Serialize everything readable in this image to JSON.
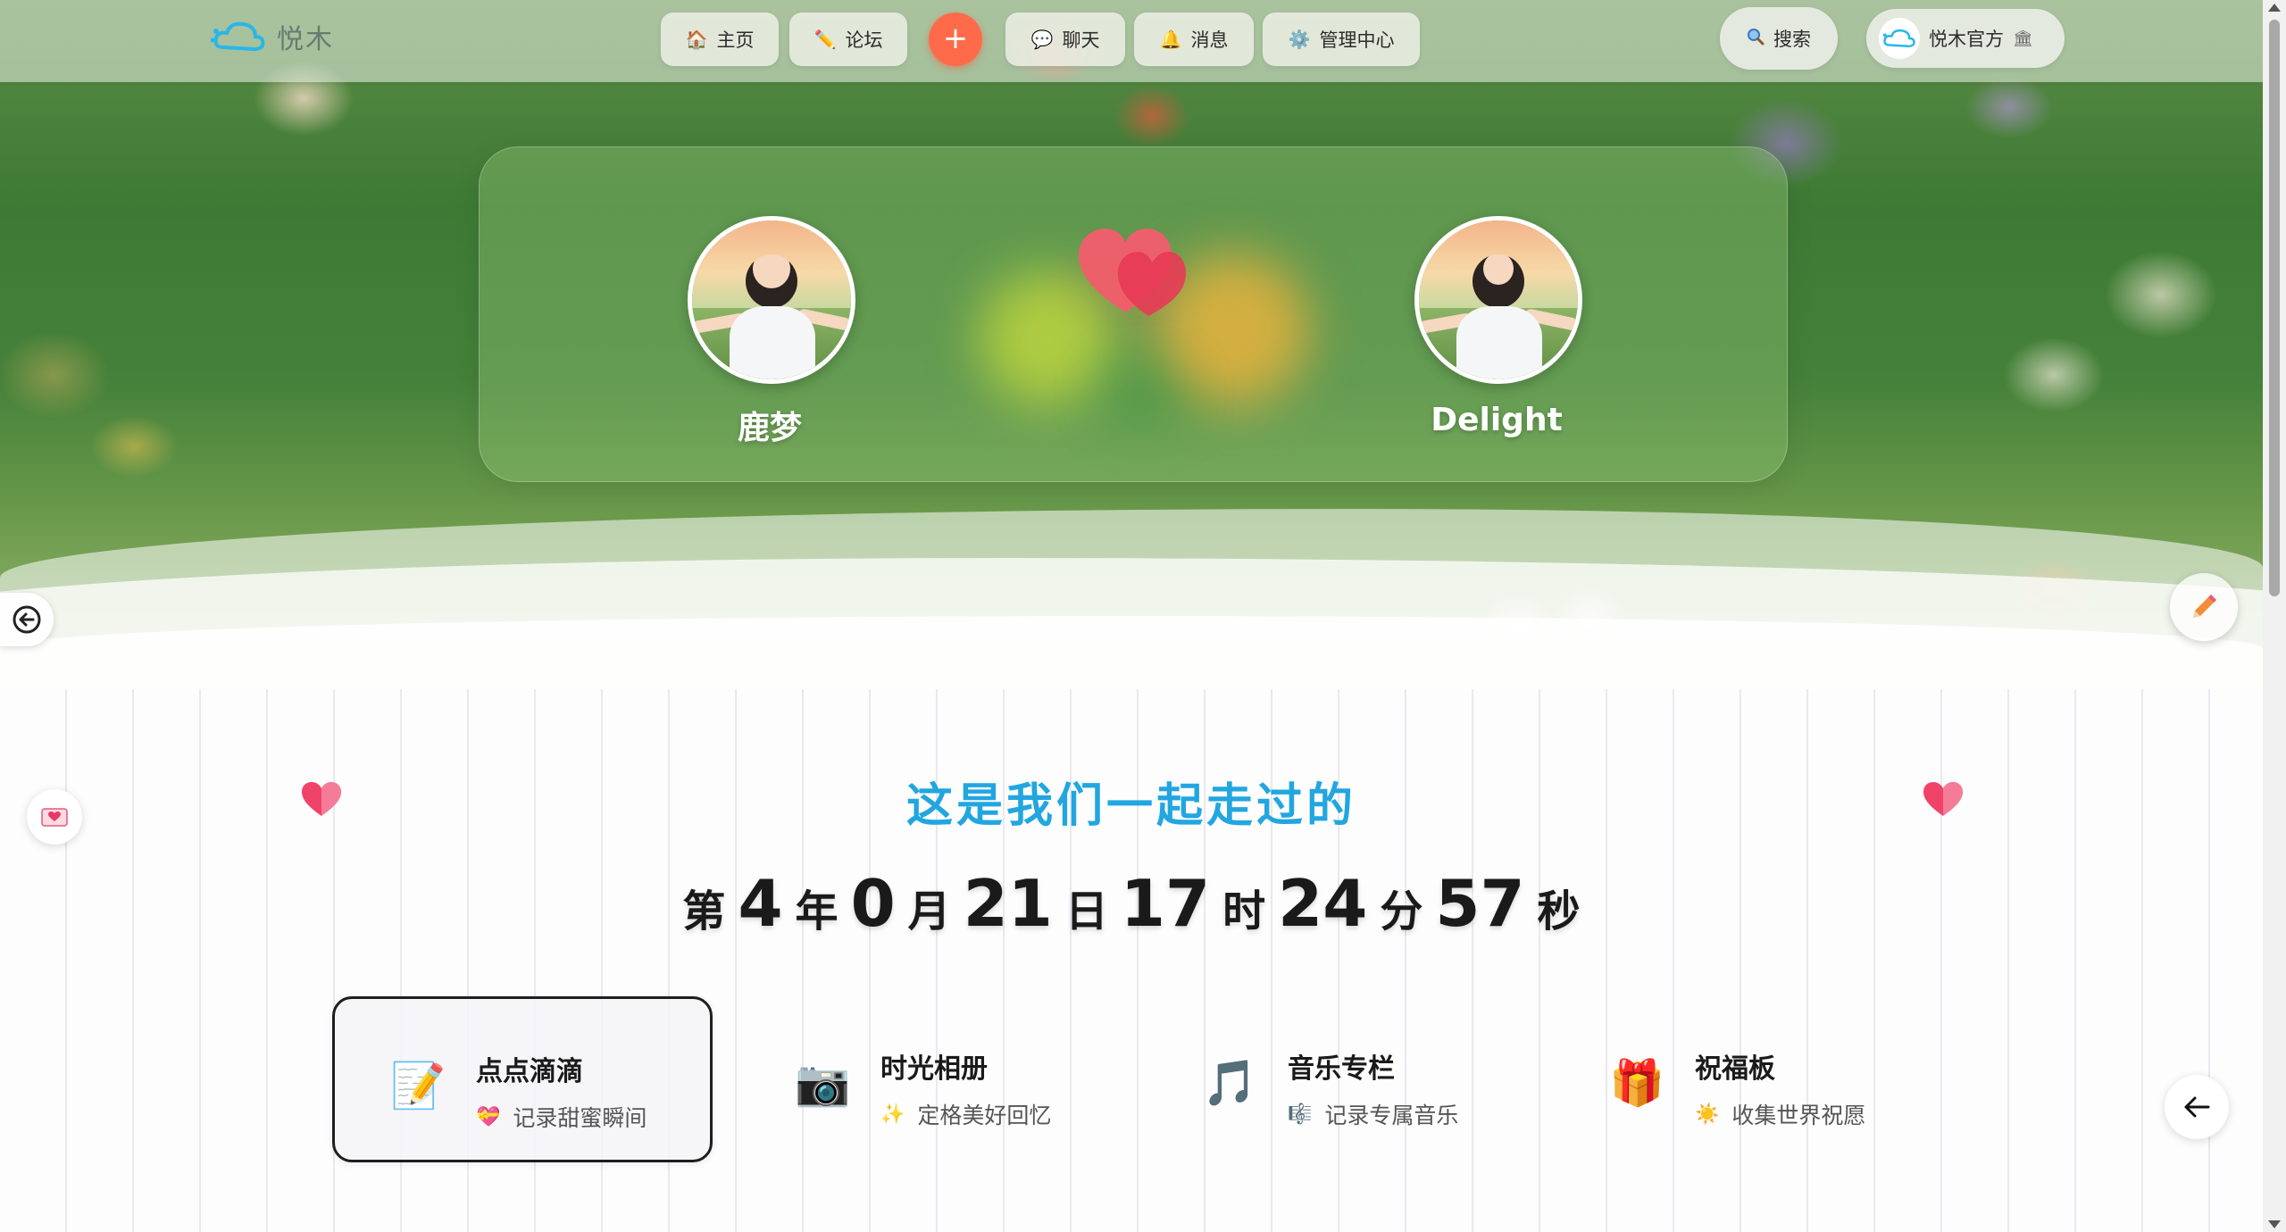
{
  "app": {
    "name": "悦木"
  },
  "nav": {
    "items": [
      {
        "label": "主页",
        "icon": "home-icon",
        "glyph": "🏠"
      },
      {
        "label": "论坛",
        "icon": "pen-icon",
        "glyph": "✏️"
      },
      {
        "label": "聊天",
        "icon": "chat-icon",
        "glyph": "💬"
      },
      {
        "label": "消息",
        "icon": "bell-icon",
        "glyph": "🔔"
      },
      {
        "label": "管理中心",
        "icon": "gear-icon",
        "glyph": "⚙️"
      }
    ],
    "plus_glyph": "+",
    "search_label": "搜索",
    "user_label": "悦木官方",
    "user_badge_glyph": "🏛"
  },
  "couple": {
    "left_name": "鹿梦",
    "right_name": "Delight"
  },
  "together": {
    "title": "这是我们一起走过的",
    "prefix": "第",
    "years": "4",
    "years_unit": "年",
    "months": "0",
    "months_unit": "月",
    "days": "21",
    "days_unit": "日",
    "hours": "17",
    "hours_unit": "时",
    "minutes": "24",
    "minutes_unit": "分",
    "seconds": "57",
    "seconds_unit": "秒"
  },
  "features": [
    {
      "title": "点点滴滴",
      "subtitle": "记录甜蜜瞬间",
      "icon": "memo-icon",
      "glyph": "📝",
      "sub_icon": "heart-icon",
      "sub_glyph": "💝"
    },
    {
      "title": "时光相册",
      "subtitle": "定格美好回忆",
      "icon": "camera-icon",
      "glyph": "📷",
      "sub_icon": "sparkles-icon",
      "sub_glyph": "✨"
    },
    {
      "title": "音乐专栏",
      "subtitle": "记录专属音乐",
      "icon": "music-icon",
      "glyph": "🎵",
      "sub_icon": "music-note-icon",
      "sub_glyph": "🎼"
    },
    {
      "title": "祝福板",
      "subtitle": "收集世界祝愿",
      "icon": "gift-icon",
      "glyph": "🎁",
      "sub_icon": "sun-icon",
      "sub_glyph": "☀️"
    }
  ],
  "colors": {
    "title": "#22a6e0",
    "plus_button": "#ff6b4a",
    "heart": "#f0436a"
  }
}
